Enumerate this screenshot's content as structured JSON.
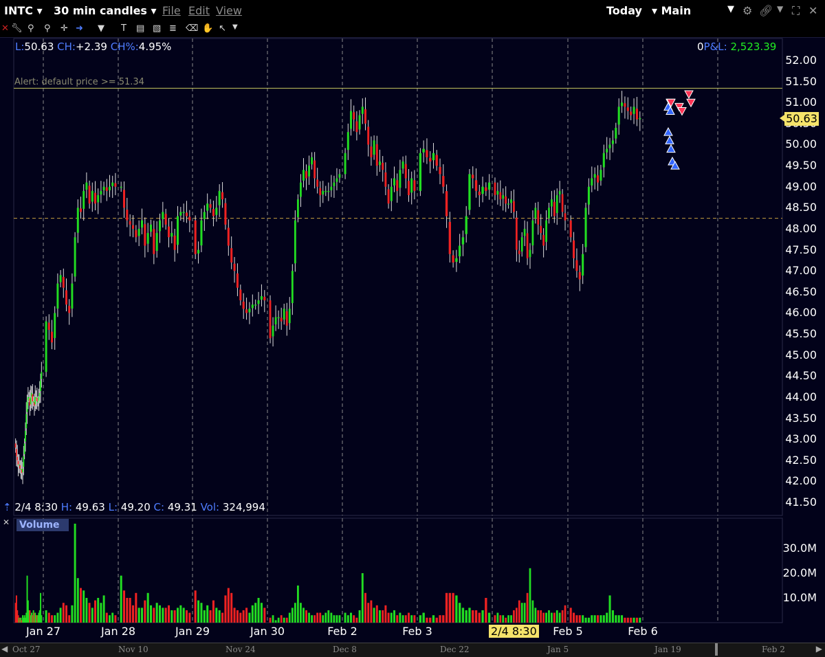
{
  "window": {
    "symbol": "INTC",
    "interval": "30 min candles",
    "menus": [
      "File",
      "Edit",
      "View"
    ],
    "period": "Today",
    "layout": "Main"
  },
  "info_bar": {
    "last_label": "L:",
    "last_value": "50.63",
    "change_label": "CH:",
    "change_value": "+2.39",
    "change_pct_label": "CH%:",
    "change_pct_value": "4.95%",
    "position": "0",
    "pnl_label": "P&L:",
    "pnl_value": "2,523.39"
  },
  "alert_text": "Alert: default price >= 51.34",
  "crosshair_bar": {
    "time": "2/4 8:30",
    "high_label": "H:",
    "high_value": "49.63",
    "low_label": "L:",
    "low_value": "49.20",
    "close_label": "C:",
    "close_value": "49.31",
    "vol_label": "Vol:",
    "vol_value": "324,994"
  },
  "volume_panel_label": "Volume",
  "current_price_tag": "50.63",
  "time_cursor_tag": "2/4 8:30",
  "colors": {
    "background": "#02021a",
    "up": "#22dd22",
    "down": "#ee2222",
    "alert_line": "#c8c860",
    "ref_line": "#c8a040",
    "buy_marker": "#3366ff",
    "sell_marker": "#ff3355"
  },
  "chart_data": {
    "type": "candlestick",
    "price_axis": {
      "ticks": [
        "52.00",
        "51.50",
        "51.00",
        "50.50",
        "50.00",
        "49.50",
        "49.00",
        "48.50",
        "48.00",
        "47.50",
        "47.00",
        "46.50",
        "46.00",
        "45.50",
        "45.00",
        "44.50",
        "44.00",
        "43.50",
        "43.00",
        "42.50",
        "42.00",
        "41.50"
      ],
      "range": [
        41.5,
        52.0
      ]
    },
    "volume_axis": {
      "ticks": [
        "30.0M",
        "20.0M",
        "10.0M"
      ],
      "range_millions": [
        0,
        30
      ]
    },
    "x_axis_ticks": [
      "Jan 27",
      "Jan 28",
      "Jan 29",
      "Jan 30",
      "Feb 2",
      "Feb 3",
      "Feb 4",
      "Feb 5",
      "Feb 6"
    ],
    "navigator_ticks": [
      "Oct 27",
      "Nov 10",
      "Nov 24",
      "Dec 8",
      "Dec 22",
      "Jan 5",
      "Jan 19",
      "Feb 2"
    ],
    "alert_level": 51.34,
    "reference_level": 48.25,
    "days": [
      {
        "day": "Jan 27",
        "closes": [
          42.8,
          42.6,
          42.5,
          42.4,
          42.4,
          42.3,
          42.3,
          42.2,
          42.3,
          42.6,
          42.9,
          43.2,
          43.6,
          43.9,
          44.0,
          44.0,
          43.8,
          44.0,
          44.1,
          43.9,
          43.9,
          43.8,
          44.0,
          44.0,
          43.9,
          43.9,
          44.0,
          44.1,
          44.4,
          44.6
        ],
        "volumes": [
          8,
          11,
          5,
          3,
          2,
          2,
          2,
          1,
          3,
          2,
          3,
          2,
          4,
          19,
          9,
          5,
          5,
          3,
          4,
          3,
          5,
          4,
          4,
          3,
          3,
          3,
          4,
          5,
          12,
          3
        ]
      },
      {
        "day": "Jan 28",
        "closes": [
          45.8,
          45.6,
          45.3,
          46.0,
          46.7,
          46.9,
          46.6,
          46.2,
          46.0,
          46.7,
          47.8,
          48.5,
          48.4,
          48.9,
          49.1,
          48.6,
          48.9,
          48.6,
          48.8,
          48.9,
          49.0,
          48.9,
          49.0,
          49.1,
          49.0
        ],
        "volumes": [
          5,
          4,
          3,
          3,
          4,
          6,
          8,
          7,
          3,
          7,
          40,
          18,
          14,
          13,
          10,
          8,
          6,
          9,
          10,
          8,
          11,
          4,
          3,
          4,
          3
        ]
      },
      {
        "day": "Jan 29",
        "closes": [
          49.0,
          48.5,
          48.2,
          48.1,
          48.0,
          47.8,
          48.0,
          48.2,
          47.6,
          47.9,
          48.1,
          47.4,
          47.9,
          48.2,
          48.4,
          48.1,
          47.8,
          47.9,
          47.5,
          48.3,
          48.4,
          48.4,
          48.3,
          48.2
        ],
        "volumes": [
          19,
          13,
          10,
          10,
          7,
          12,
          6,
          6,
          9,
          12,
          7,
          6,
          8,
          7,
          6,
          6,
          7,
          5,
          5,
          6,
          7,
          6,
          5,
          4
        ]
      },
      {
        "day": "Jan 30",
        "closes": [
          47.4,
          47.5,
          48.2,
          48.4,
          48.6,
          48.5,
          48.3,
          48.5,
          48.9,
          48.7,
          48.1,
          47.6,
          47.2,
          47.0,
          46.6,
          46.3,
          46.1,
          46.0,
          46.1,
          46.2,
          46.2,
          46.3,
          46.4,
          46.3
        ],
        "volumes": [
          13,
          9,
          8,
          5,
          7,
          5,
          9,
          6,
          5,
          4,
          11,
          14,
          12,
          6,
          5,
          4,
          5,
          6,
          4,
          7,
          8,
          10,
          8,
          6
        ]
      },
      {
        "day": "Feb 2",
        "closes": [
          45.4,
          45.7,
          45.9,
          45.9,
          45.8,
          46.1,
          45.7,
          46.1,
          47.0,
          48.2,
          48.7,
          49.1,
          49.4,
          49.2,
          49.5,
          49.7,
          49.2,
          49.0,
          48.8,
          48.9,
          48.9,
          48.9,
          49.0,
          49.1,
          49.2,
          49.3
        ],
        "volumes": [
          2,
          3,
          1,
          2,
          3,
          2,
          2,
          4,
          6,
          8,
          15,
          8,
          6,
          5,
          4,
          3,
          3,
          4,
          4,
          3,
          4,
          5,
          4,
          3,
          3,
          3
        ]
      },
      {
        "day": "Feb 3",
        "closes": [
          49.8,
          50.3,
          50.8,
          50.6,
          50.3,
          50.7,
          50.9,
          50.5,
          50.0,
          49.7,
          50.1,
          49.5,
          49.6,
          49.4,
          49.0,
          48.6,
          49.0,
          49.2,
          48.9,
          49.4,
          49.6,
          49.2,
          48.8,
          49.2,
          48.9
        ],
        "volumes": [
          4,
          3,
          4,
          3,
          2,
          5,
          20,
          12,
          8,
          9,
          6,
          7,
          5,
          5,
          7,
          4,
          4,
          5,
          3,
          4,
          3,
          3,
          4,
          3,
          3
        ]
      },
      {
        "day": "Feb 4",
        "closes": [
          49.8,
          49.9,
          49.7,
          49.6,
          49.8,
          49.5,
          49.3,
          49.0,
          48.3,
          47.4,
          47.2,
          47.3,
          47.6,
          47.8,
          48.3,
          49.3,
          49.2,
          48.9,
          48.8,
          49.0,
          48.9,
          49.1
        ],
        "volumes": [
          3,
          4,
          2,
          2,
          3,
          2,
          3,
          3,
          12,
          12,
          12,
          11,
          8,
          6,
          5,
          6,
          5,
          5,
          4,
          5,
          10,
          4
        ]
      },
      {
        "day": "Feb 5",
        "closes": [
          48.8,
          48.9,
          48.7,
          48.8,
          48.6,
          48.6,
          48.7,
          48.4,
          47.5,
          47.4,
          47.8,
          48.0,
          47.3,
          47.5,
          48.2,
          48.5,
          48.1,
          47.9,
          47.6,
          48.2,
          48.5,
          48.7,
          48.3,
          48.8,
          48.9,
          48.4,
          48.2
        ],
        "volumes": [
          3,
          4,
          3,
          3,
          2,
          3,
          3,
          5,
          6,
          9,
          8,
          8,
          12,
          22,
          9,
          6,
          5,
          5,
          4,
          4,
          5,
          4,
          4,
          5,
          4,
          5,
          7
        ]
      },
      {
        "day": "Feb 6",
        "closes": [
          47.8,
          47.3,
          47.0,
          46.8,
          47.4,
          48.5,
          49.0,
          49.2,
          49.3,
          49.1,
          49.4,
          49.8,
          49.9,
          50.0,
          50.1,
          50.4,
          50.9,
          51.0,
          50.9,
          50.8,
          50.7,
          50.9,
          50.6,
          50.63
        ],
        "volumes": [
          6,
          4,
          3,
          3,
          3,
          2,
          2,
          3,
          3,
          3,
          3,
          3,
          4,
          11,
          5,
          3,
          3,
          3,
          2,
          2,
          2,
          2,
          2,
          2
        ]
      }
    ],
    "buy_markers": [
      50.9,
      50.3,
      50.1,
      49.9,
      49.6,
      49.5,
      50.8
    ],
    "sell_markers": [
      51.0,
      50.9,
      50.8,
      51.0,
      51.2,
      51.0
    ]
  }
}
